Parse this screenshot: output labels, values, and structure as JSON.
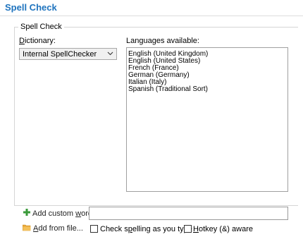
{
  "header": {
    "title": "Spell Check"
  },
  "group": {
    "legend": "Spell Check"
  },
  "dictionary": {
    "label_pre": "",
    "label_accel": "D",
    "label_post": "ictionary:",
    "selected": "Internal SpellChecker"
  },
  "languages": {
    "label": "Languages available:",
    "items": [
      "English (United Kingdom)",
      "English (United States)",
      "French (France)",
      "German (Germany)",
      "Italian (Italy)",
      "Spanish (Traditional Sort)"
    ]
  },
  "custom_word": {
    "label_pre": "Add custom ",
    "label_accel": "w",
    "label_post": "ord",
    "value": ""
  },
  "add_from_file": {
    "label_pre": "",
    "label_accel": "A",
    "label_post": "dd from file..."
  },
  "check_spelling": {
    "label_pre": "Check s",
    "label_accel": "p",
    "label_post": "elling as you type",
    "checked": false
  },
  "hotkey_aware": {
    "label_pre": "",
    "label_accel": "H",
    "label_post": "otkey (&) aware",
    "checked": false
  },
  "colors": {
    "accent": "#1e73be",
    "plus_icon": "#3a9a3a",
    "folder_icon": "#e8a838"
  },
  "icons": {
    "add_custom_word": "plus-icon",
    "add_from_file": "folder-icon",
    "dropdown": "chevron-down-icon"
  }
}
